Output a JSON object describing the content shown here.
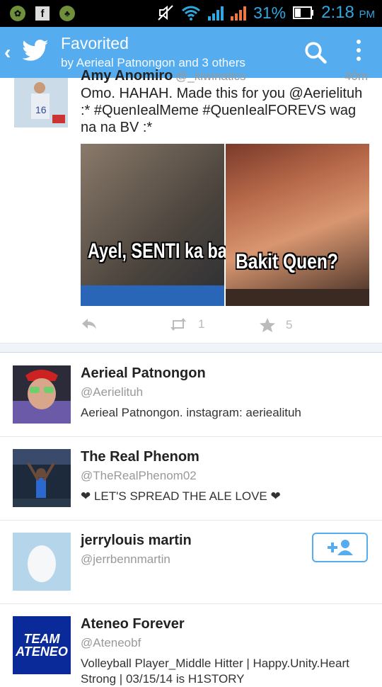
{
  "status_bar": {
    "battery_percent": "31%",
    "time": "2:18",
    "ampm": "PM",
    "icons": [
      "app-icon-1",
      "facebook-icon",
      "app-icon-2",
      "silent-icon",
      "wifi-icon",
      "signal-icon",
      "signal-icon-2",
      "battery-icon"
    ]
  },
  "app_bar": {
    "back_label": "‹",
    "title": "Favorited",
    "subtitle": "by Aerieal Patnongon and 3 others"
  },
  "tweet": {
    "name": "Amy Anomiro",
    "handle": "@_kiwinatics",
    "time": "40m",
    "text": "Omo. HAHAH. Made this for you @Aerielituh :* #QuenIealMeme #QuenIealFOREVS wag na na BV :*",
    "media_caption_left": "Ayel, SENTI ka ba?",
    "media_caption_right": "Bakit Quen?",
    "retweet_count": "1",
    "favorite_count": "5"
  },
  "users": [
    {
      "name": "Aerieal Patnongon",
      "handle": "@Aerielituh",
      "bio": "Aerieal Patnongon. instagram: aeriealituh"
    },
    {
      "name": "The Real Phenom",
      "handle": "@TheRealPhenom02",
      "bio": "❤ LET'S SPREAD THE ALE LOVE ❤"
    },
    {
      "name": "jerrylouis martin",
      "handle": "@jerrbennmartin",
      "bio": ""
    },
    {
      "name": "Ateneo Forever",
      "handle": "@Ateneobf",
      "bio": "Volleyball Player_Middle Hitter | Happy.Unity.Heart Strong | 03/15/14 is H1STORY",
      "avatar_text": "TEAM ATENEO"
    }
  ],
  "colors": {
    "accent": "#55acee",
    "status_blue": "#2fa8e0"
  }
}
